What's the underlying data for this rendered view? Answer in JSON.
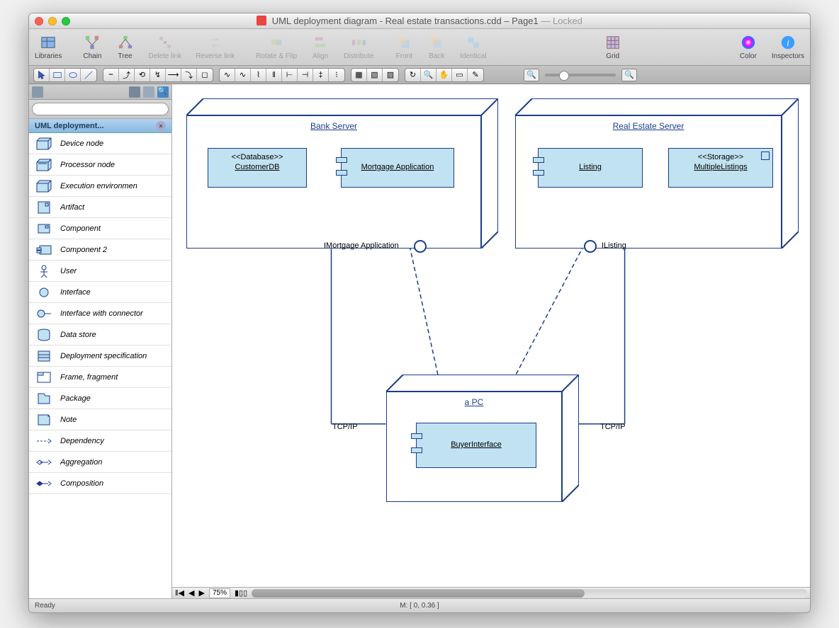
{
  "window": {
    "title_doc": "UML deployment diagram - Real estate transactions.cdd",
    "title_page": "Page1",
    "locked": "Locked"
  },
  "toolbar": {
    "libraries": "Libraries",
    "chain": "Chain",
    "tree": "Tree",
    "delete_link": "Delete link",
    "reverse_link": "Reverse link",
    "rotate_flip": "Rotate & Flip",
    "align": "Align",
    "distribute": "Distribute",
    "front": "Front",
    "back": "Back",
    "identical": "Identical",
    "grid": "Grid",
    "color": "Color",
    "inspectors": "Inspectors"
  },
  "sidebar": {
    "header": "UML deployment...",
    "search_placeholder": "",
    "items": [
      "Device node",
      "Processor node",
      "Execution environmen",
      "Artifact",
      "Component",
      "Component 2",
      "User",
      "Interface",
      "Interface with connector",
      "Data store",
      "Deployment specification",
      "Frame, fragment",
      "Package",
      "Note",
      "Dependency",
      "Aggregation",
      "Composition"
    ]
  },
  "diagram": {
    "bank_server": "Bank Server",
    "customer_db_stereo": "<<Database>>",
    "customer_db": "CustomerDB",
    "mortgage_app": "Mortgage Application",
    "imortgage": "IMortgage Application",
    "real_estate_server": "Real Estate Server",
    "listing": "Listing",
    "storage_stereo": "<<Storage>>",
    "multiple_listings": "MultipleListings",
    "ilisting": "IListing",
    "a_pc": "a PC",
    "buyer_interface": "BuyerInterface",
    "tcpip_left": "TCP/IP",
    "tcpip_right": "TCP/IP"
  },
  "footer": {
    "zoom": "75%",
    "ready": "Ready",
    "coords": "M: [ 0, 0.36 ]"
  }
}
